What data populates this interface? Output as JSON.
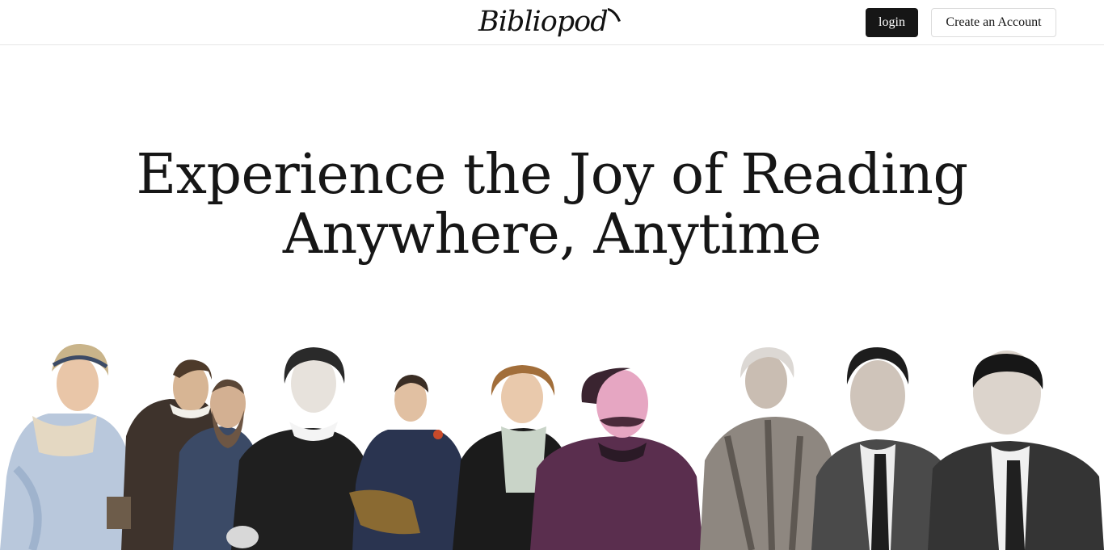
{
  "header": {
    "logo_text": "Bibliopod",
    "login_label": "login",
    "create_account_label": "Create an Account"
  },
  "hero": {
    "line1": "Experience the Joy of Reading",
    "line2": "Anywhere, Anytime"
  },
  "authors_collage": {
    "figures": [
      {
        "name": "author-portrait-1",
        "icon": "woman-bonnet-blue-dress"
      },
      {
        "name": "author-portrait-2",
        "icon": "man-ruff-collar"
      },
      {
        "name": "author-portrait-3",
        "icon": "bearded-man"
      },
      {
        "name": "author-portrait-4",
        "icon": "woman-lace-collar"
      },
      {
        "name": "author-portrait-5",
        "icon": "man-seated-chair"
      },
      {
        "name": "author-portrait-6",
        "icon": "woman-curls"
      },
      {
        "name": "author-portrait-7",
        "icon": "man-moustache-pink"
      },
      {
        "name": "author-portrait-8",
        "icon": "woman-poncho"
      },
      {
        "name": "author-portrait-9",
        "icon": "man-suit-cigarette"
      },
      {
        "name": "author-portrait-10",
        "icon": "man-bald-suit"
      }
    ]
  },
  "colors": {
    "login_bg": "#161616",
    "text": "#141414",
    "border": "#dcdcdc"
  }
}
